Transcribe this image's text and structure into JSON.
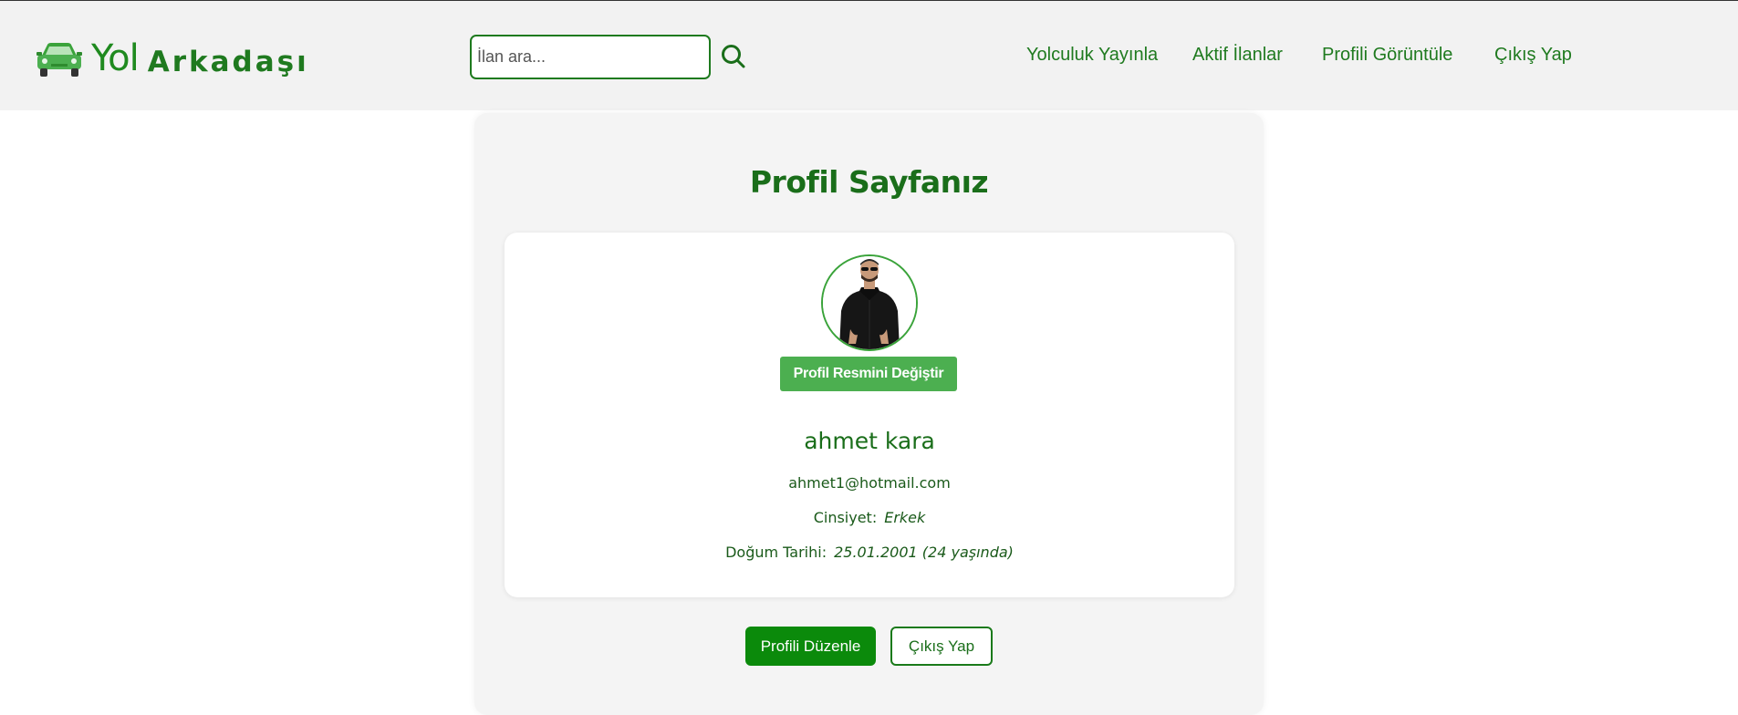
{
  "brand": {
    "name_part1": "Yol",
    "name_part2": "Arkadaşı",
    "logo_icon": "car-icon"
  },
  "search": {
    "placeholder": "İlan ara...",
    "value": "",
    "icon": "search-icon"
  },
  "nav": {
    "items": [
      {
        "label": "Yolculuk Yayınla"
      },
      {
        "label": "Aktif İlanlar"
      },
      {
        "label": "Profili Görüntüle"
      },
      {
        "label": "Çıkış Yap"
      }
    ]
  },
  "profile": {
    "title": "Profil Sayfanız",
    "change_photo_label": "Profil Resmini Değiştir",
    "name": "ahmet kara",
    "email": "ahmet1@hotmail.com",
    "gender_label": "Cinsiyet:",
    "gender_value": "Erkek",
    "birth_label": "Doğum Tarihi:",
    "birth_value": "25.01.2001 (24 yaşında)"
  },
  "actions": {
    "edit_label": "Profili Düzenle",
    "logout_label": "Çıkış Yap"
  },
  "colors": {
    "accent": "#1f7a1f",
    "header_bg": "#f2f2f2",
    "button_green": "#0b8a0b",
    "photo_button": "#4caf50"
  }
}
